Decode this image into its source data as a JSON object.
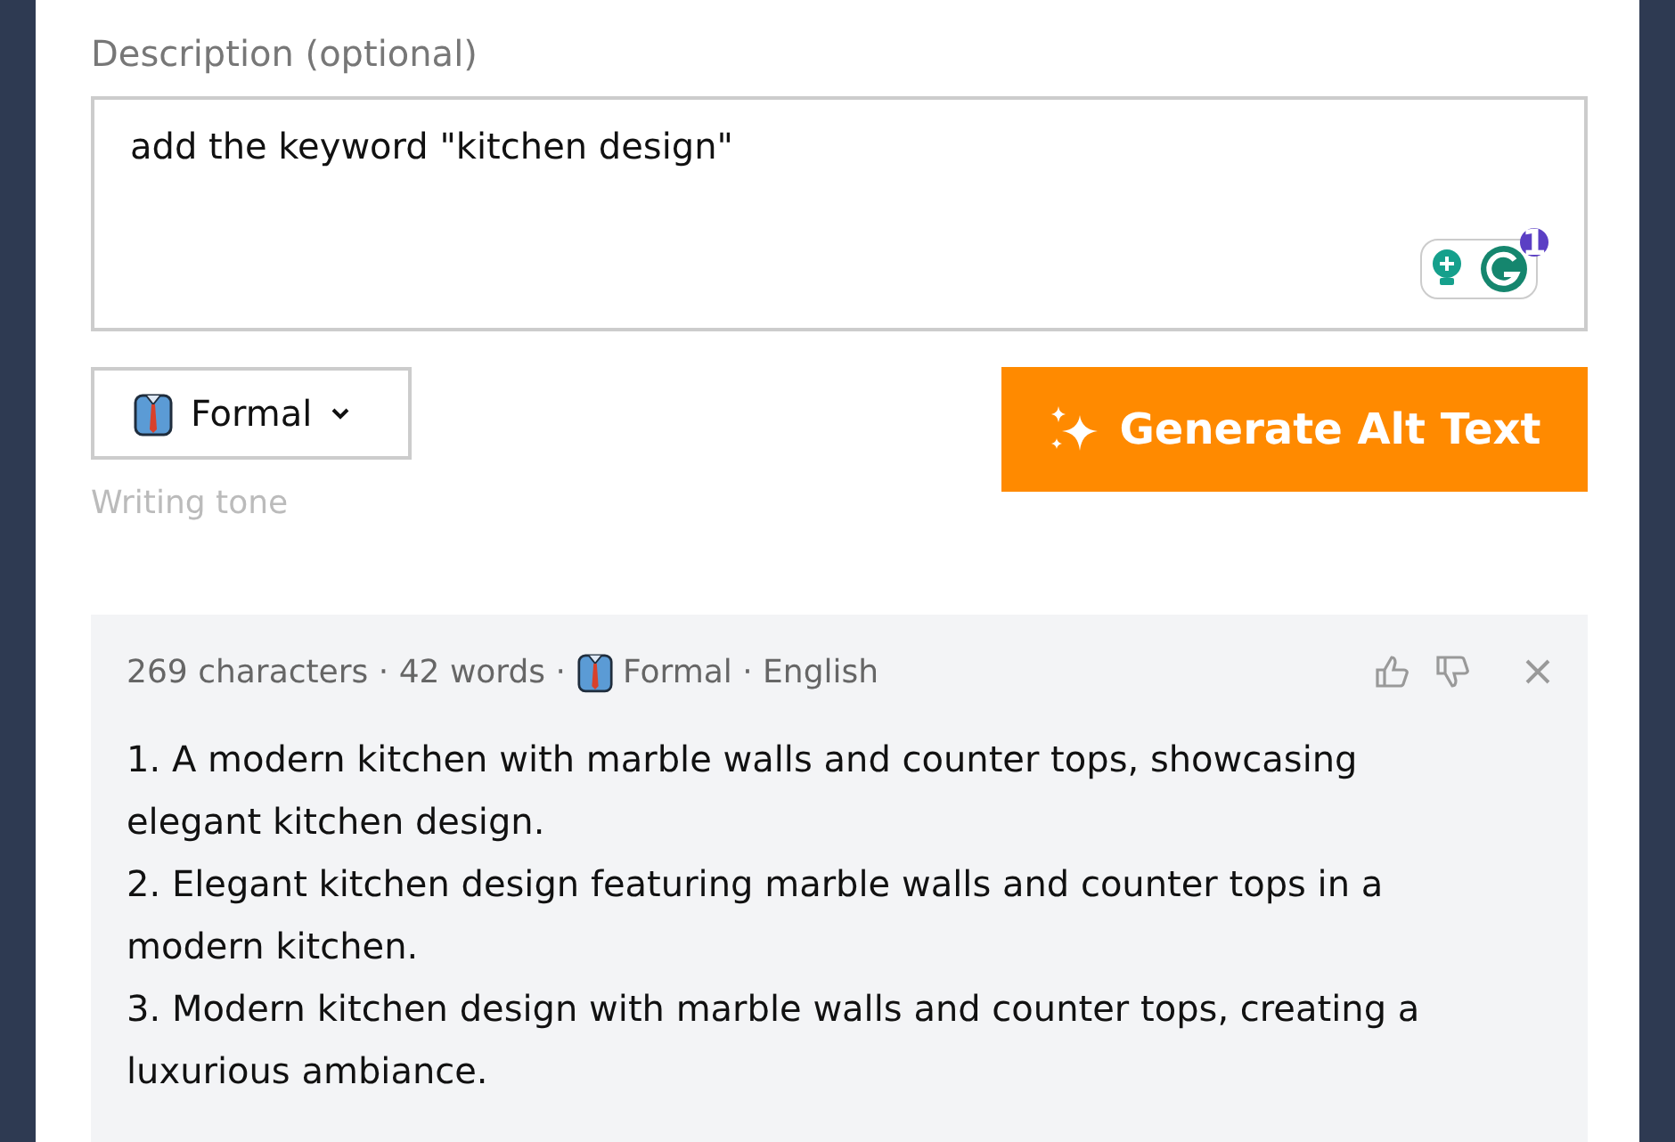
{
  "description": {
    "label": "Description (optional)",
    "value": "add the keyword \"kitchen design\"",
    "grammarly_badge": "1"
  },
  "tone": {
    "value": "Formal",
    "hint": "Writing tone"
  },
  "generate_button": {
    "label": "Generate Alt Text"
  },
  "result": {
    "stats": "269 characters · 42 words ·",
    "tone": "Formal · English",
    "lines": [
      "1. A modern kitchen with marble walls and counter tops, showcasing elegant kitchen design.",
      "2. Elegant kitchen design featuring marble walls and counter tops in a modern kitchen.",
      "3. Modern kitchen design with marble walls and counter tops, creating a luxurious ambiance."
    ]
  }
}
